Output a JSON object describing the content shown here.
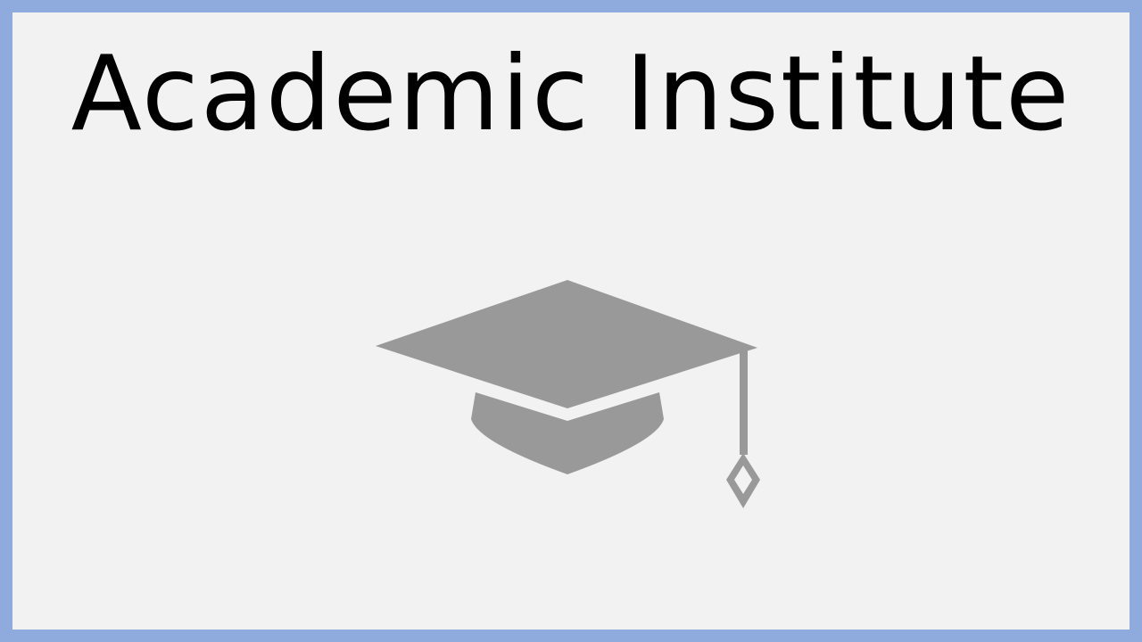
{
  "slide": {
    "title": "Academic Institute"
  },
  "icon": {
    "name": "graduation-cap-icon",
    "color": "#999999"
  },
  "colors": {
    "border": "#8faadc",
    "background": "#f2f2f2",
    "title": "#000000"
  }
}
